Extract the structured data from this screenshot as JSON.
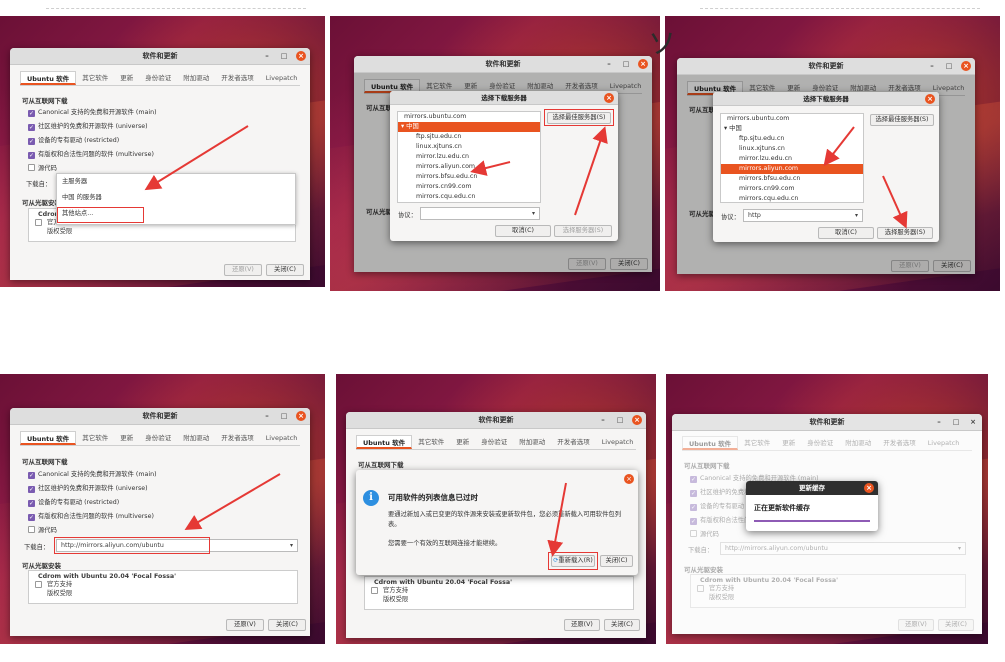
{
  "colors": {
    "accent": "#e95420",
    "check": "#7a5bb0",
    "highlight": "#e53935",
    "progress": "#8e5bb5"
  },
  "window_title": "软件和更新",
  "tabs": [
    "Ubuntu 软件",
    "其它软件",
    "更新",
    "身份验证",
    "附加驱动",
    "开发者选项",
    "Livepatch"
  ],
  "sections": {
    "internet": "可从互联网下载",
    "cdrom": "可从光驱安装"
  },
  "checks": [
    "Canonical 支持的免费和开源软件 (main)",
    "社区维护的免费和开源软件 (universe)",
    "设备的专有驱动 (restricted)",
    "有版权和合法性问题的软件 (multiverse)",
    "源代码"
  ],
  "download_from_label": "下载自：",
  "download_from_value": "http://mirrors.aliyun.com/ubuntu",
  "download_from_value_short": "http://mirrors.aliyun.com/ubuntu",
  "server_menu": [
    "主服务器",
    "中国 的服务器",
    "其他站点..."
  ],
  "cdrom": {
    "title": "Cdrom with Ubuntu 20.04 'Focal Fossa'",
    "items": [
      "官方支持",
      "版权受限"
    ]
  },
  "buttons": {
    "revert": "还原(V)",
    "close": "关闭(C)",
    "cancel": "取消(C)",
    "choose_server": "选择服务器(S)",
    "best_server": "选择最佳服务器(S)",
    "reload": "重新载入(R)"
  },
  "choose_dialog": {
    "title": "选择下载服务器",
    "servers": [
      "mirrors.ubuntu.com",
      "中国",
      "ftp.sjtu.edu.cn",
      "linux.xjtuns.cn",
      "mirror.lzu.edu.cn",
      "mirrors.aliyun.com",
      "mirrors.bfsu.edu.cn",
      "mirrors.cn99.com",
      "mirrors.cqu.edu.cn"
    ],
    "protocol_label": "协议：",
    "protocol_value": "http"
  },
  "outdated_dialog": {
    "title": "可用软件的列表信息已过时",
    "body": "要通过新加入或已变更的软件源来安装或更新软件包，您必须重新载入可用软件包列表。",
    "note": "您需要一个有效的互联网连接才能继续。"
  },
  "cache_dialog": {
    "title": "更新缓存",
    "message": "正在更新软件缓存"
  },
  "partial_text_top": "ソ"
}
